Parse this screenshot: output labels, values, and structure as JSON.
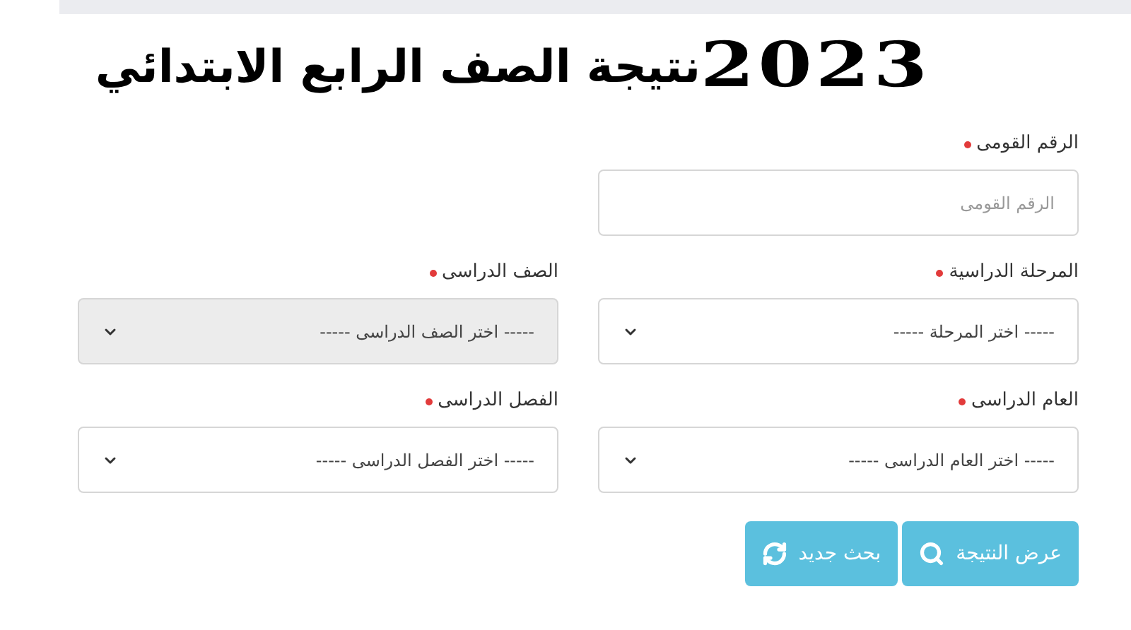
{
  "heading": {
    "year": "2023",
    "title": "نتيجة الصف الرابع الابتدائي"
  },
  "fields": [
    {
      "kind": "text",
      "label": "الرقم القومى",
      "required": true,
      "placeholder": "الرقم القومى",
      "disabled": false
    },
    {
      "kind": "spacer"
    },
    {
      "kind": "select",
      "label": "المرحلة الدراسية",
      "required": true,
      "value": "----- اختر المرحلة -----",
      "disabled": false
    },
    {
      "kind": "select",
      "label": "الصف الدراسى",
      "required": true,
      "value": "----- اختر الصف الدراسى -----",
      "disabled": true
    },
    {
      "kind": "select",
      "label": "العام الدراسى",
      "required": true,
      "value": "----- اختر العام الدراسى -----",
      "disabled": false
    },
    {
      "kind": "select",
      "label": "الفصل الدراسى",
      "required": true,
      "value": "----- اختر الفصل الدراسى -----",
      "disabled": false
    }
  ],
  "buttons": [
    {
      "kind": "search",
      "label": "عرض النتيجة"
    },
    {
      "kind": "reset",
      "label": "بحث جديد"
    }
  ]
}
